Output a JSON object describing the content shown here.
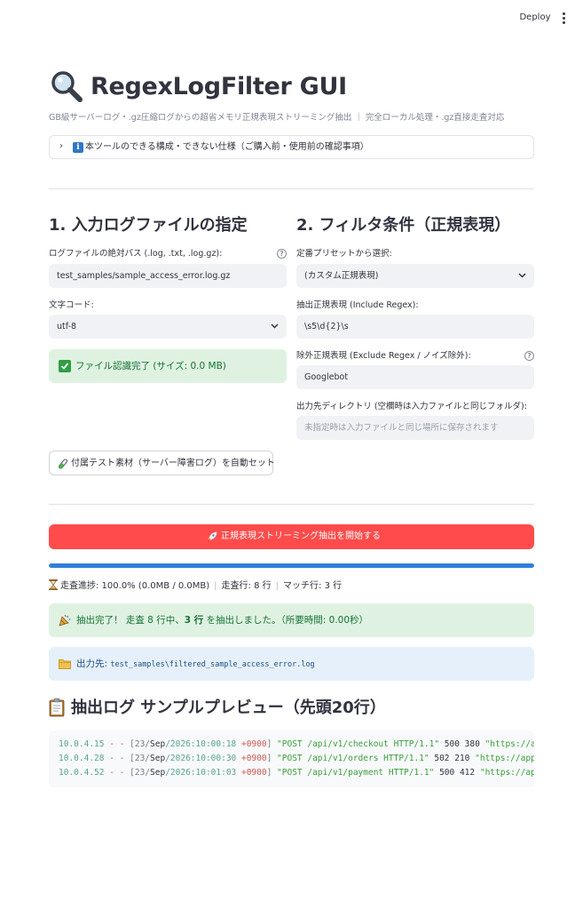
{
  "header": {
    "deploy_label": "Deploy",
    "menu_icon": "vertical-dots-icon"
  },
  "app": {
    "title": "RegexLogFilter GUI",
    "title_icon": "magnifier-icon",
    "subtitle": "GB級サーバーログ・.gz圧縮ログからの超省メモリ正規表現ストリーミング抽出 ｜ 完全ローカル処理・.gz直接走査対応"
  },
  "expander": {
    "label": "本ツールのできる構成・できない仕様（ご購入前・使用前の確認事項）",
    "icon": "info-icon"
  },
  "input_section": {
    "title": "1. 入力ログファイルの指定",
    "path_label": "ログファイルの絶対パス (.log, .txt, .log.gz):",
    "path_value": "test_samples/sample_access_error.log.gz",
    "encoding_label": "文字コード:",
    "encoding_value": "utf-8",
    "status_text": "ファイル認識完了 (サイズ: 0.0 MB)",
    "sample_button_label": "付属テスト素材（サーバー障害ログ）を自動セット"
  },
  "filter_section": {
    "title": "2. フィルタ条件（正規表現）",
    "preset_label": "定番プリセットから選択:",
    "preset_value": "(カスタム正規表現)",
    "include_label": "抽出正規表現 (Include Regex):",
    "include_value": "\\s5\\d{2}\\s",
    "exclude_label": "除外正規表現 (Exclude Regex / ノイズ除外):",
    "exclude_value": "Googlebot",
    "output_label": "出力先ディレクトリ (空欄時は入力ファイルと同じフォルダ):",
    "output_placeholder": "未指定時は入力ファイルと同じ場所に保存されます"
  },
  "run": {
    "button_label": "正規表現ストリーミング抽出を開始する",
    "button_icon": "rocket-icon",
    "progress_fraction": 1.0,
    "progress_text": "走査進捗: 100.0% (0.0MB / 0.0MB)",
    "scanned_text": "走査行: 8 行",
    "matched_text": "マッチ行: 3 行"
  },
  "result": {
    "done_prefix": "抽出完了！ 走査 8 行中、",
    "done_bold": "3 行",
    "done_suffix": " を抽出しました。（所要時間: 0.00秒）",
    "output_label": "出力先:",
    "output_path": "test_samples\\filtered_sample_access_error.log"
  },
  "preview": {
    "title": "抽出ログ サンプルプレビュー（先頭20行）",
    "lines": [
      {
        "ip": "10.0.4.15",
        "dashes": "- -",
        "d1": "[23/",
        "mon": "Sep",
        "d2": "/2026:10:00:18 ",
        "tz": "+0900",
        "d3": "] ",
        "req": "\"POST /api/v1/checkout HTTP/1.1\"",
        "rest": " 500 380 ",
        "ref": "\"https://a"
      },
      {
        "ip": "10.0.4.28",
        "dashes": "- -",
        "d1": "[23/",
        "mon": "Sep",
        "d2": "/2026:10:00:30 ",
        "tz": "+0900",
        "d3": "] ",
        "req": "\"POST /api/v1/orders HTTP/1.1\"",
        "rest": " 502 210 ",
        "ref": "\"https://app"
      },
      {
        "ip": "10.0.4.52",
        "dashes": "- -",
        "d1": "[23/",
        "mon": "Sep",
        "d2": "/2026:10:01:03 ",
        "tz": "+0900",
        "d3": "] ",
        "req": "\"POST /api/v1/payment HTTP/1.1\"",
        "rest": " 500 412 ",
        "ref": "\"https://ap"
      }
    ]
  },
  "colors": {
    "primary": "#ff4b4b",
    "success_bg": "#dff2e2",
    "info_bg": "#e6f0fb",
    "progress": "#2f80d8"
  }
}
